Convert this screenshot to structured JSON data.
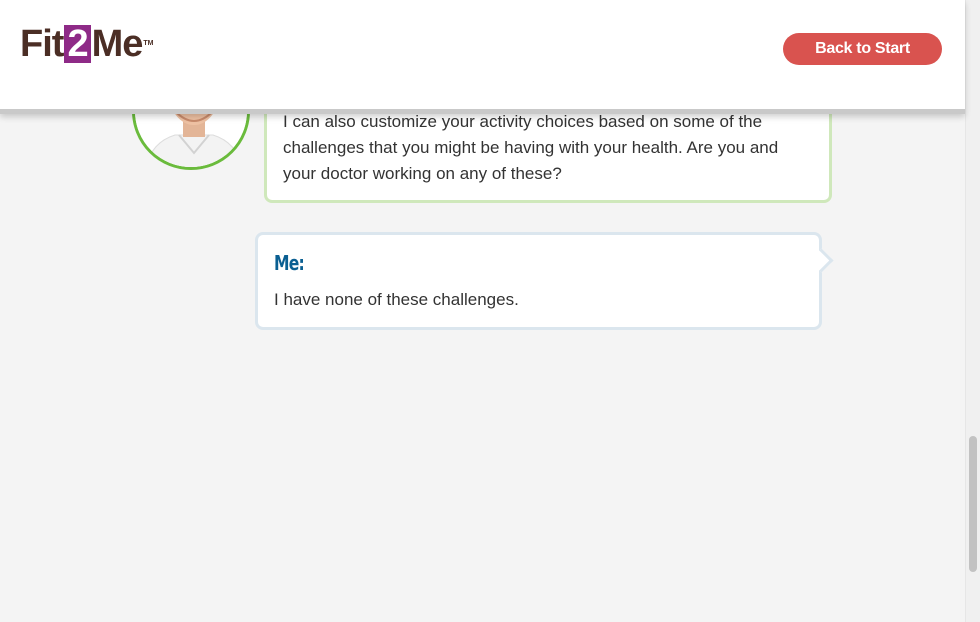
{
  "header": {
    "logo": {
      "part1": "Fit",
      "part2": "2",
      "part3": "Me",
      "trademark": "TM"
    },
    "back_button_label": "Back to Start"
  },
  "conversation": {
    "coach_message": "I can also customize your activity choices based on some of the challenges that you might be having with your health. Are you and your doctor working on any of these?",
    "me_label": "Me:",
    "me_message": "I have none of these challenges."
  },
  "colors": {
    "accent_red": "#d9534f",
    "brand_purple": "#8e2a87",
    "brand_brown": "#4b2e25",
    "avatar_ring_green": "#6abb3c",
    "me_label_blue": "#0a5f92"
  },
  "icons": {
    "avatar": "coach-avatar"
  }
}
